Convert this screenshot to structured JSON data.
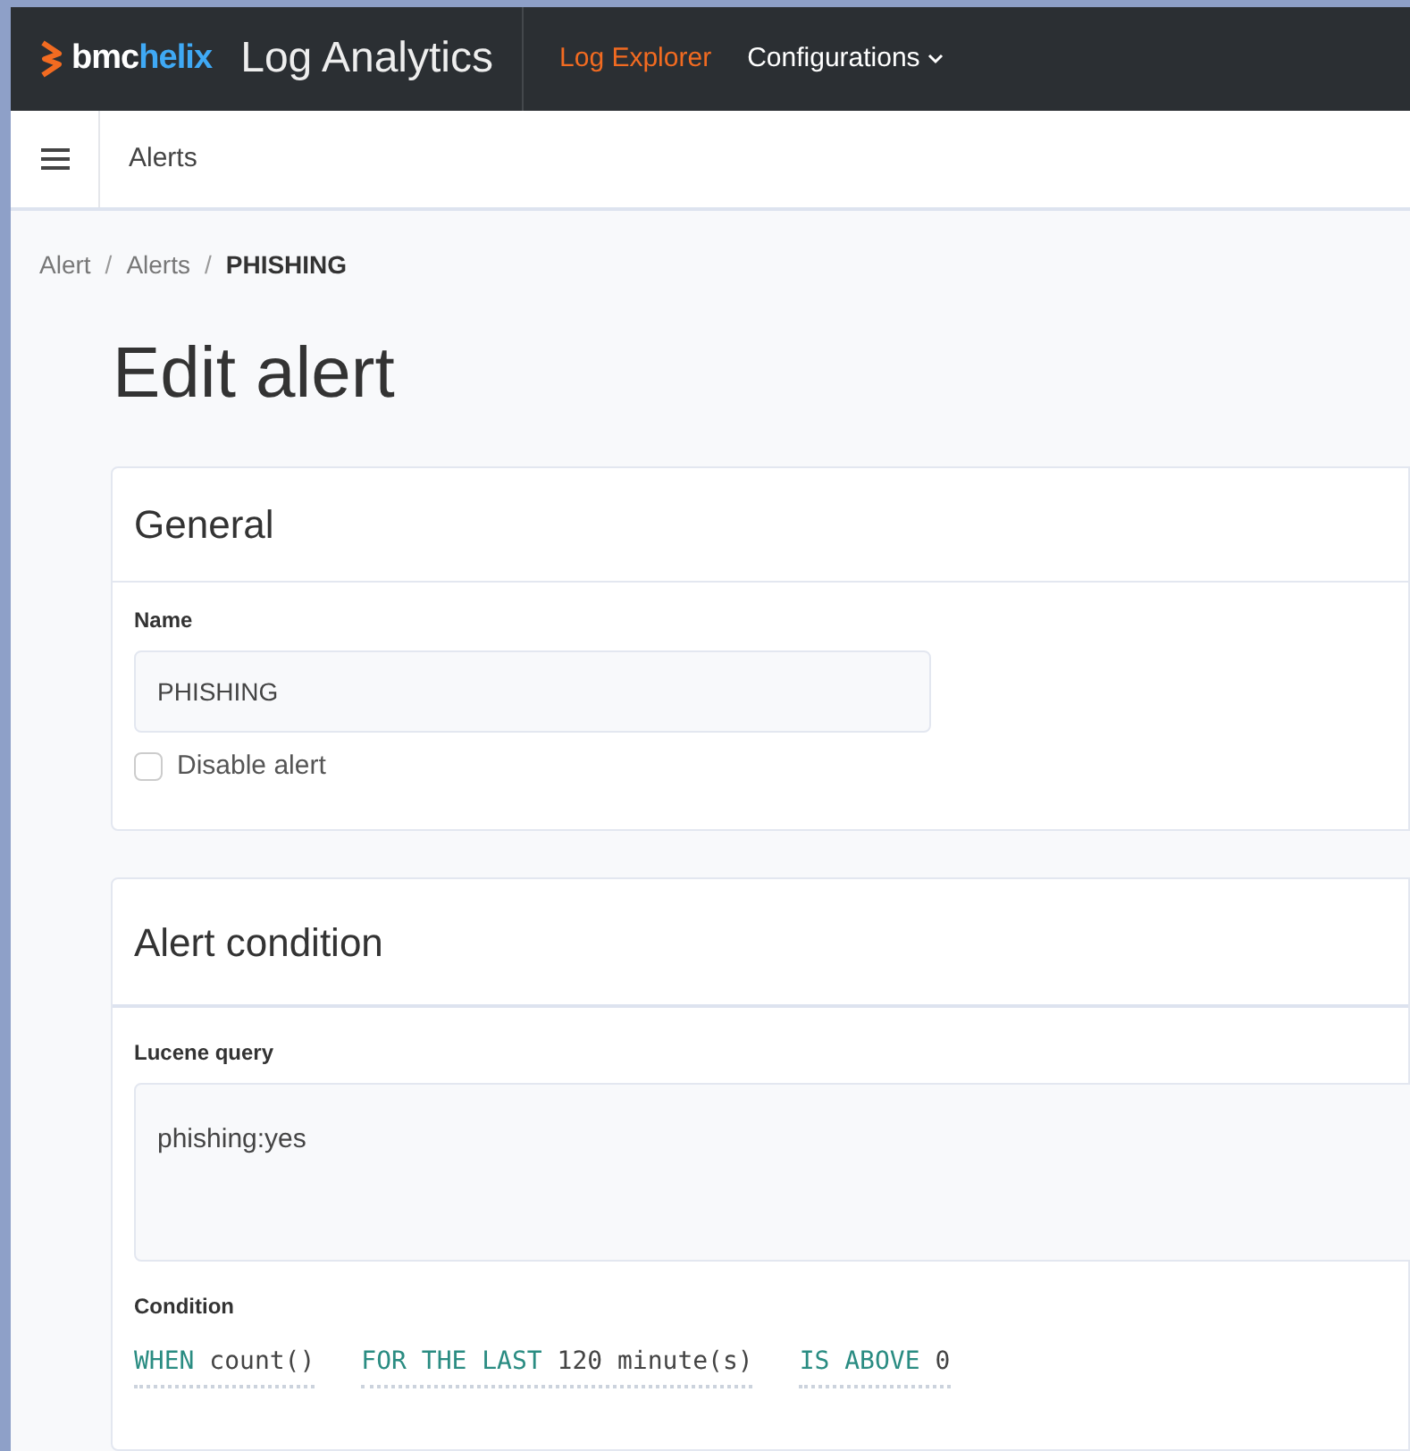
{
  "header": {
    "brand_bmc": "bmc",
    "brand_helix": "helix",
    "product": "Log Analytics",
    "nav": [
      {
        "label": "Log Explorer",
        "selected": true,
        "dropdown": false
      },
      {
        "label": "Configurations",
        "selected": false,
        "dropdown": true
      }
    ]
  },
  "subheader": {
    "title": "Alerts"
  },
  "breadcrumb": {
    "separator": "/",
    "items": [
      "Alert",
      "Alerts",
      "PHISHING"
    ]
  },
  "page_title": "Edit alert",
  "general": {
    "title": "General",
    "name_label": "Name",
    "name_value": "PHISHING",
    "disable": {
      "label": "Disable alert",
      "checked": false
    }
  },
  "condition_card": {
    "title": "Alert condition",
    "query_label": "Lucene query",
    "query_value": "phishing:yes",
    "condition_label": "Condition",
    "clauses": [
      {
        "keyword": "WHEN",
        "value": "count()"
      },
      {
        "keyword": "FOR THE LAST",
        "value": "120 minute(s)"
      },
      {
        "keyword": "IS ABOVE",
        "value": "0"
      }
    ]
  }
}
